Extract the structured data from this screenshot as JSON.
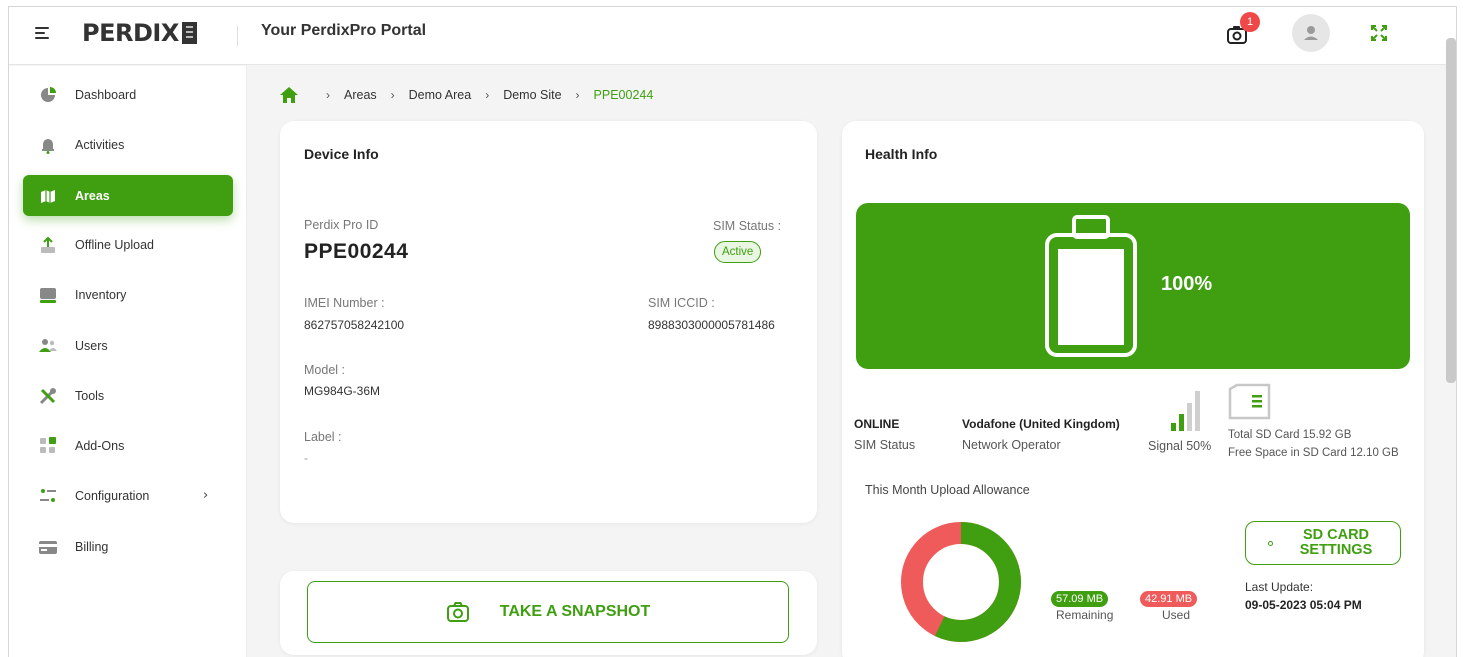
{
  "header": {
    "logo_text": "PERDIX",
    "portal_title": "Your PerdixPro Portal",
    "notification_count": "1"
  },
  "sidebar": {
    "items": [
      {
        "label": "Dashboard",
        "icon": "dashboard-icon"
      },
      {
        "label": "Activities",
        "icon": "bell-icon"
      },
      {
        "label": "Areas",
        "icon": "map-icon",
        "active": true
      },
      {
        "label": "Offline Upload",
        "icon": "upload-icon"
      },
      {
        "label": "Inventory",
        "icon": "inventory-icon"
      },
      {
        "label": "Users",
        "icon": "users-icon"
      },
      {
        "label": "Tools",
        "icon": "tools-icon"
      },
      {
        "label": "Add-Ons",
        "icon": "addons-icon"
      },
      {
        "label": "Configuration",
        "icon": "configuration-icon",
        "has_submenu": true
      },
      {
        "label": "Billing",
        "icon": "billing-icon"
      }
    ]
  },
  "breadcrumb": {
    "items": [
      "Areas",
      "Demo Area",
      "Demo Site"
    ],
    "current": "PPE00244"
  },
  "device_info": {
    "title": "Device Info",
    "id_label": "Perdix Pro ID",
    "id_value": "PPE00244",
    "sim_status_label": "SIM Status :",
    "sim_status_value": "Active",
    "imei_label": "IMEI Number :",
    "imei_value": "862757058242100",
    "iccid_label": "SIM ICCID :",
    "iccid_value": "8988303000005781486",
    "model_label": "Model :",
    "model_value": "MG984G-36M",
    "label_label": "Label :",
    "label_value": "-"
  },
  "snapshot": {
    "button_label": "TAKE A SNAPSHOT"
  },
  "health_info": {
    "title": "Health Info",
    "battery_percent_text": "100%",
    "battery_level": 1.0,
    "sim_status_value": "ONLINE",
    "sim_status_label": "SIM Status",
    "network_operator_value": "Vodafone (United Kingdom)",
    "network_operator_label": "Network Operator",
    "signal_text": "Signal 50%",
    "signal_level": 0.5,
    "sd_total": "Total SD Card 15.92 GB",
    "sd_free": "Free Space in SD Card 12.10 GB",
    "upload_allowance_title": "This Month Upload Allowance",
    "remaining_value": "57.09 MB",
    "remaining_label": "Remaining",
    "used_value": "42.91 MB",
    "used_label": "Used",
    "remaining_mb": 57.09,
    "used_mb": 42.91,
    "sd_settings_label": "SD CARD SETTINGS",
    "last_update_label": "Last Update:",
    "last_update_value": "09-05-2023 05:04 PM"
  },
  "colors": {
    "accent": "#3f9f11",
    "danger": "#ef5b5b",
    "badge": "#ef4848"
  }
}
